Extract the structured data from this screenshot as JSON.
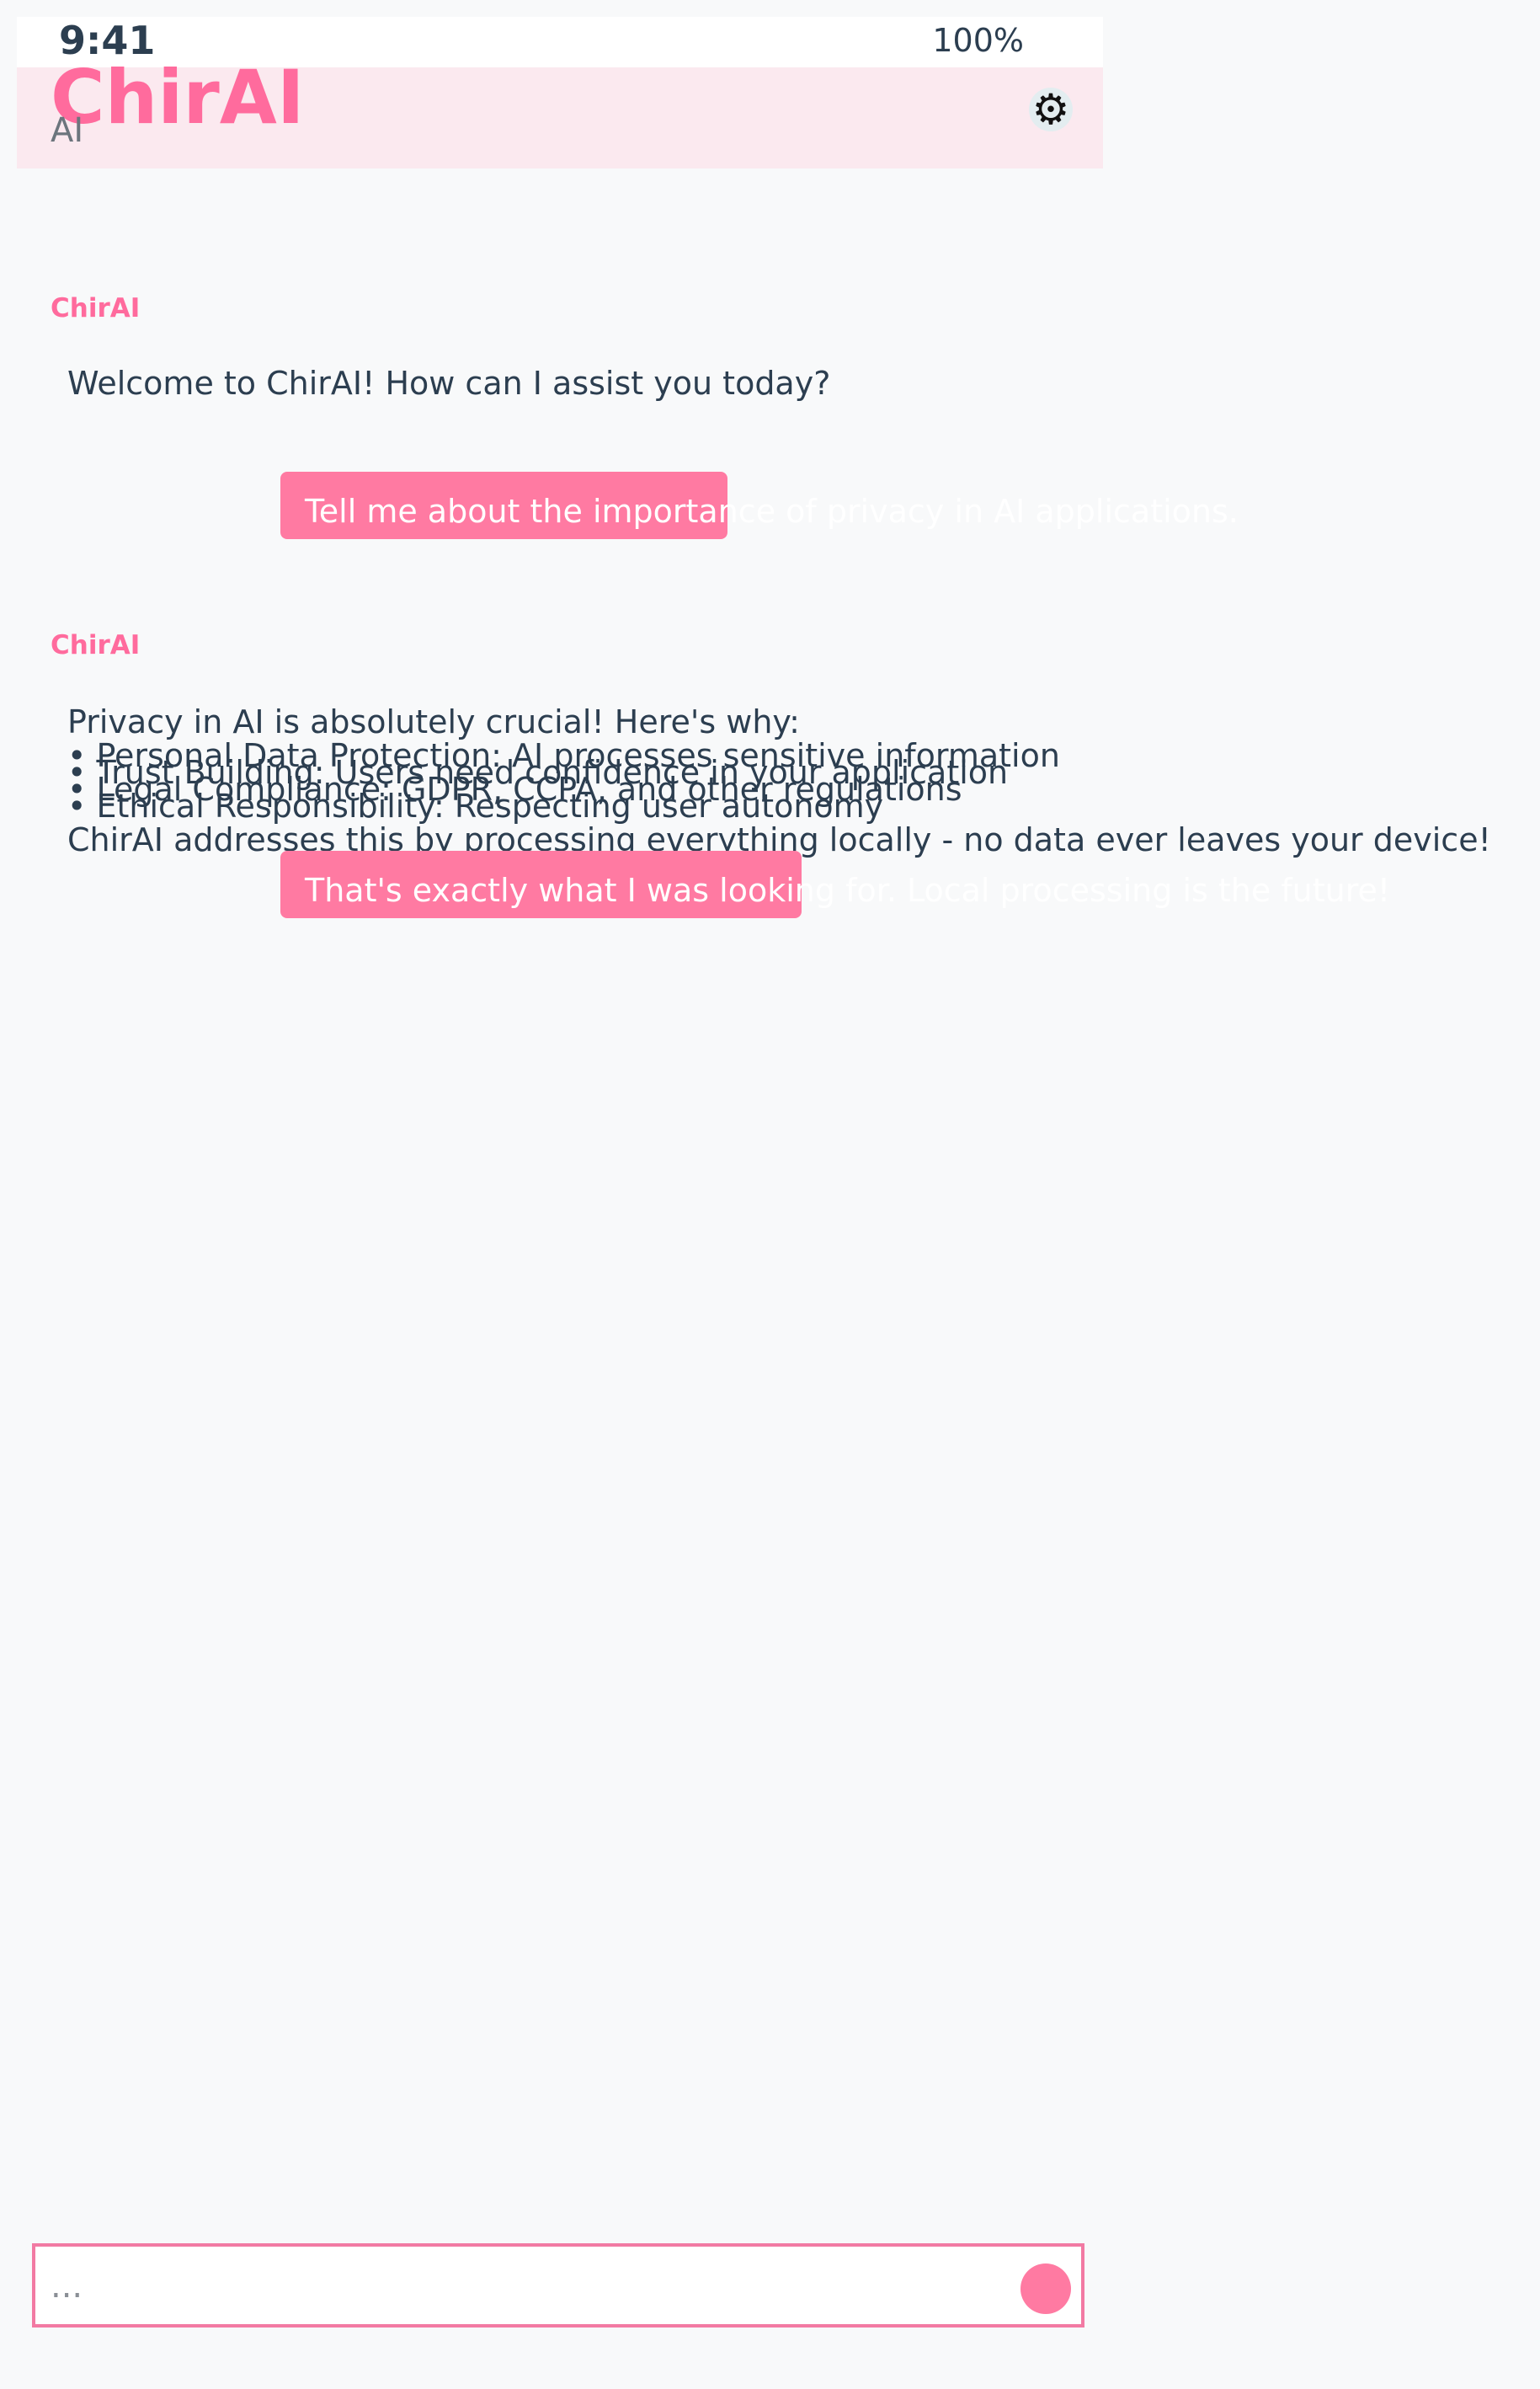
{
  "status_bar": {
    "time": "9:41",
    "battery": "100%",
    "signal_icon": "",
    "battery_icon": ""
  },
  "header": {
    "title": " ChirAI",
    "subtitle": "AI",
    "settings_icon": "⚙"
  },
  "messages": [
    {
      "role": "bot",
      "sender": " ChirAI",
      "text": " Welcome to ChirAI! How can I assist you today?"
    },
    {
      "role": "user",
      "text": "Tell me about the importance of privacy in AI applications."
    },
    {
      "role": "bot",
      "sender": " ChirAI",
      "lines": [
        "Privacy in AI is absolutely crucial! Here's why:",
        "• Personal Data Protection: AI processes sensitive information",
        "• Trust Building: Users need confidence in your application",
        "• Legal Compliance: GDPR, CCPA, and other regulations",
        "• Ethical Responsibility: Respecting user autonomy",
        "ChirAI addresses this by processing everything locally - no data ever leaves your device!"
      ]
    },
    {
      "role": "user",
      "text": "That's exactly what I was looking for. Local processing is the future!"
    }
  ],
  "input": {
    "placeholder": "...",
    "value": "",
    "send_icon": ""
  },
  "colors": {
    "accent": "#ff6b9d",
    "user_bubble": "#ff7aa2",
    "header_bg": "#fbe9ef",
    "page_bg": "#f8f9fa",
    "text": "#2c3e50"
  }
}
